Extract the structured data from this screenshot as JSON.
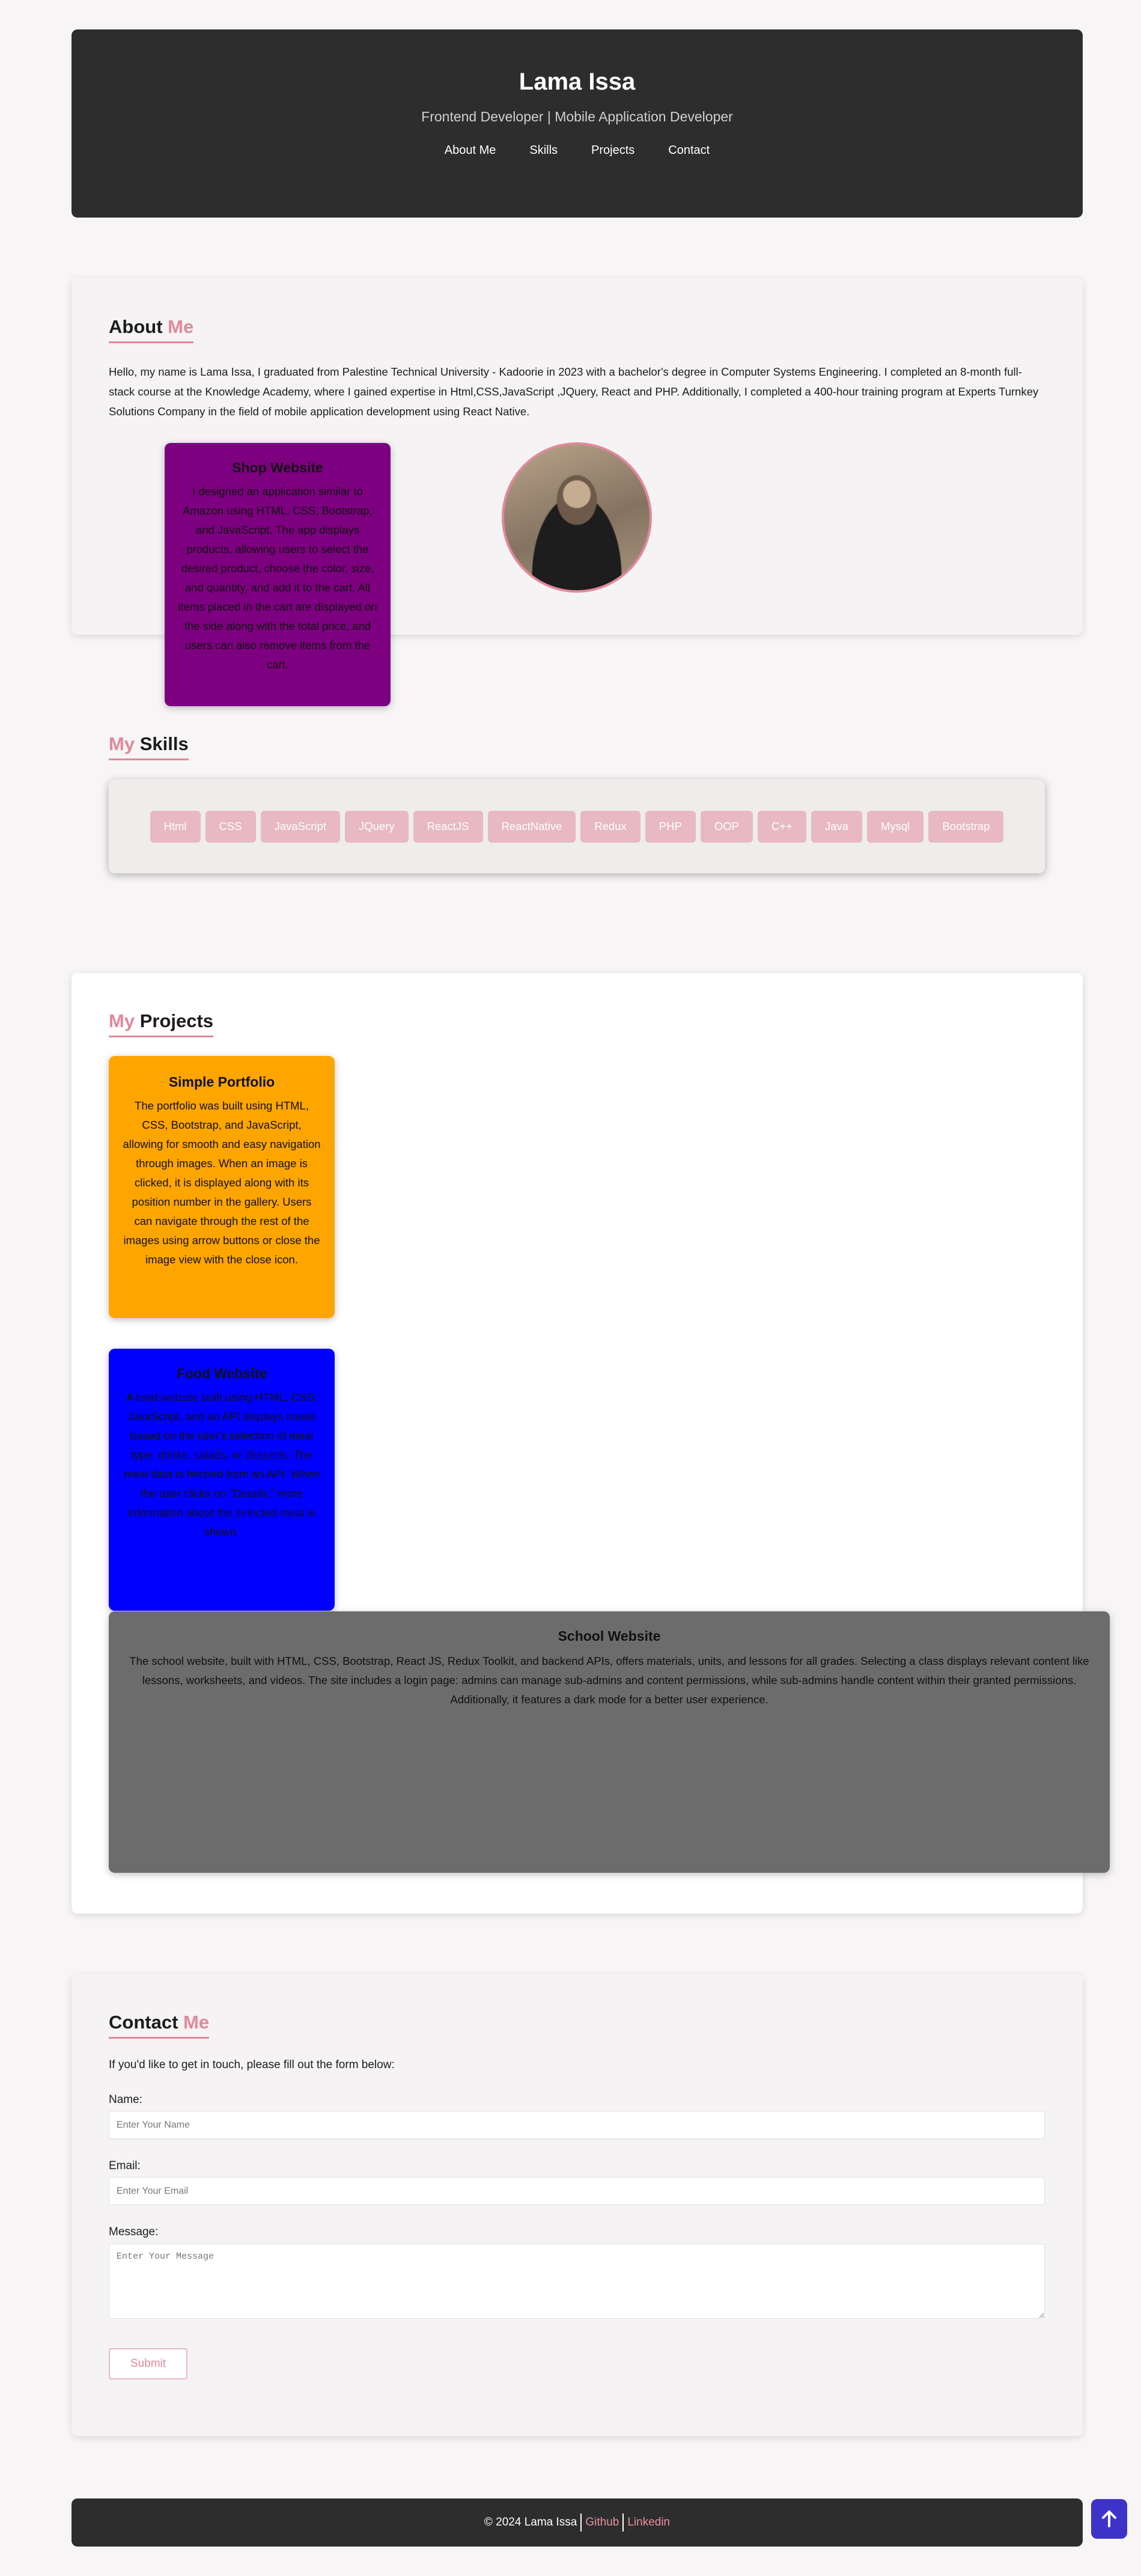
{
  "header": {
    "name": "Lama Issa",
    "subtitle": "Frontend Developer | Mobile Application Developer",
    "nav": [
      "About Me",
      "Skills",
      "Projects",
      "Contact"
    ]
  },
  "about": {
    "title_main": "About",
    "title_accent": "Me",
    "text": "Hello, my name is Lama Issa, I graduated from Palestine Technical University - Kadoorie in 2023 with a bachelor's degree in Computer Systems Engineering. I completed an 8-month full-stack course at the Knowledge Academy, where I gained expertise in Html,CSS,JavaScript ,JQuery, React and PHP. Additionally, I completed a 400-hour training program at Experts Turnkey Solutions Company in the field of mobile application development using React Native."
  },
  "skills": {
    "title_accent": "My",
    "title_main": "Skills",
    "items": [
      "Html",
      "CSS",
      "JavaScript",
      "JQuery",
      "ReactJS",
      "ReactNative",
      "Redux",
      "PHP",
      "OOP",
      "C++",
      "Java",
      "Mysql",
      "Bootstrap"
    ]
  },
  "projects": {
    "title_accent": "My",
    "title_main": "Projects",
    "items": [
      {
        "title": "Shop Website",
        "color": "#7d0080",
        "description": "I designed an application similar to Amazon using HTML, CSS, Bootstrap, and JavaScript. The app displays products, allowing users to select the desired product, choose the color, size, and quantity, and add it to the cart. All items placed in the cart are displayed on the side along with the total price, and users can also remove items from the cart."
      },
      {
        "title": "Simple Portfolio",
        "color": "#ffa500",
        "description": "The portfolio was built using HTML, CSS, Bootstrap, and JavaScript, allowing for smooth and easy navigation through images. When an image is clicked, it is displayed along with its position number in the gallery. Users can navigate through the rest of the images using arrow buttons or close the image view with the close icon."
      },
      {
        "title": "Food Website",
        "color": "#0000ff",
        "description": "A food website built using HTML, CSS, JavaScript, and an API displays meals based on the user's selection of meal type: drinks, salads, or desserts. The meal data is fetched from an API. When the user clicks on \"Details,\" more information about the selected meal is shown."
      },
      {
        "title": "School Website",
        "color": "#6c6c6c",
        "description": "The school website, built with HTML, CSS, Bootstrap, React JS, Redux Toolkit, and backend APIs, offers materials, units, and lessons for all grades. Selecting a class displays relevant content like lessons, worksheets, and videos. The site includes a login page: admins can manage sub-admins and content permissions, while sub-admins handle content within their granted permissions. Additionally, it features a dark mode for a better user experience."
      }
    ]
  },
  "contact": {
    "title_main": "Contact",
    "title_accent": "Me",
    "lead": "If you'd like to get in touch, please fill out the form below:",
    "name_label": "Name:",
    "name_placeholder": "Enter Your Name",
    "email_label": "Email:",
    "email_placeholder": "Enter Your Email",
    "message_label": "Message:",
    "message_placeholder": "Enter Your Message",
    "submit_label": "Submit"
  },
  "footer": {
    "copyright": "© 2024 Lama Issa",
    "github": "Github",
    "linkedin": "Linkedin"
  },
  "scroll_top_icon": "arrow-up-icon",
  "colors": {
    "accent": "#e0899b",
    "dark": "#2d2d2d",
    "skill_chip": "#e8b9c2",
    "scroll_button": "#3e33c9"
  }
}
